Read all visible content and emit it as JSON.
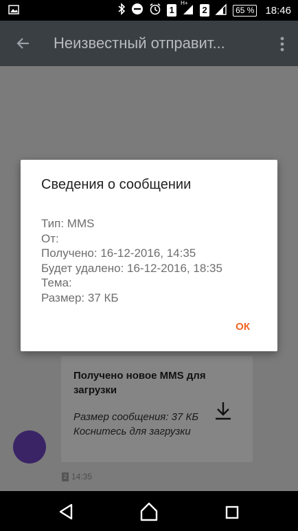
{
  "status_bar": {
    "sim1": "1",
    "sim2": "2",
    "network_type": "H+",
    "battery": "65 %",
    "time": "18:46"
  },
  "toolbar": {
    "title": "Неизвестный отправит..."
  },
  "message": {
    "title": "Получено новое MMS для загрузки",
    "body": "Размер сообщения: 37 КБ Коснитесь для загрузки",
    "timestamp": "14:35",
    "sim_badge": "2"
  },
  "dialog": {
    "title": "Сведения о сообщении",
    "lines": [
      "Тип: MMS",
      "От:",
      "Получено: 16-12-2016, 14:35",
      "Будет удалено: 16-12-2016, 18:35",
      "Тема:",
      "Размер: 37 КБ"
    ],
    "ok_label": "ОК"
  },
  "colors": {
    "accent": "#f26522",
    "toolbar": "#3a3f44",
    "avatar": "#3a2466"
  }
}
